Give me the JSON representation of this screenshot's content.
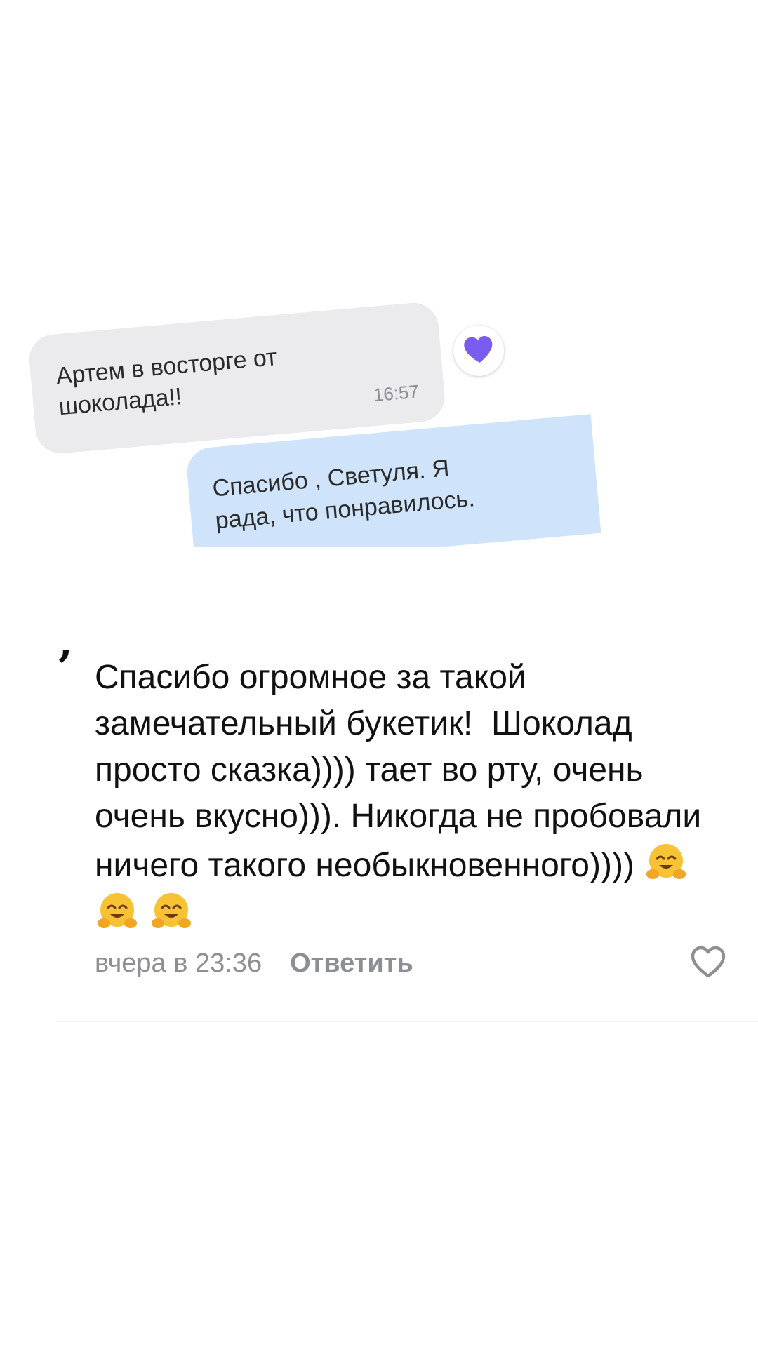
{
  "chat": {
    "incoming_message": {
      "text": "Артем в восторге от\nшоколада!!",
      "time": "16:57"
    },
    "reaction_icon": "purple-heart",
    "outgoing_message": {
      "text": "Спасибо , Светуля. Я\nрада, что понравилось."
    }
  },
  "comment": {
    "text": "Спасибо огромное за такой замечательный букетик!  Шоколад просто сказка)))) тает во рту, очень очень вкусно))). Никогда не пробовали ничего такого необыкновенного)))) ",
    "emoji": "hugging-face",
    "time": "вчера в 23:36",
    "reply_label": "Ответить",
    "like_icon": "heart-outline"
  },
  "colors": {
    "incoming_bubble": "#ebebee",
    "outgoing_bubble": "#cfe3fb",
    "reaction_heart": "#7b5cf0",
    "secondary_text": "#8e8e93"
  }
}
